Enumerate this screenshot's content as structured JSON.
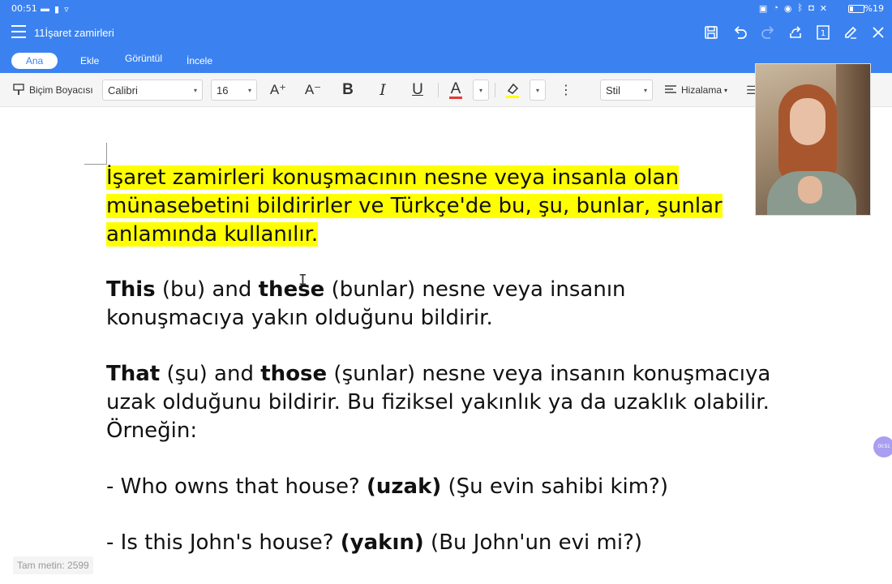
{
  "status_bar": {
    "time": "00:51",
    "battery_percent": "%19",
    "icons": [
      "video-icon",
      "sim-icon",
      "wifi-icon",
      "cast-icon",
      "speed-icon",
      "eye-icon",
      "bluetooth-icon",
      "camera-icon",
      "mute-icon",
      "battery-icon"
    ]
  },
  "title_bar": {
    "doc_title": "11İşaret zamirleri",
    "page_number": "1",
    "icons": [
      "menu-icon",
      "save-icon",
      "undo-icon",
      "redo-icon",
      "share-icon",
      "page-icon",
      "edit-icon",
      "close-icon"
    ]
  },
  "tabs": [
    {
      "label": "Ana Sayfa",
      "active": true
    },
    {
      "label": "Ekle",
      "active": false
    },
    {
      "label": "Görüntül",
      "active": false
    },
    {
      "label": "İncele",
      "active": false
    }
  ],
  "toolbar": {
    "format_painter_label": "Biçim Boyacısı",
    "font_name": "Calibri",
    "font_size": "16",
    "grow_font_glyph": "A⁺",
    "shrink_font_glyph": "A⁻",
    "bold_glyph": "B",
    "italic_glyph": "I",
    "underline_glyph": "U",
    "font_color_glyph": "A",
    "more_glyph": "⋮",
    "style_label": "Stil",
    "align_label": "Hizalama",
    "colors": {
      "font_color": "#e53935",
      "highlight": "#ffff00",
      "accent": "#3b82f0"
    }
  },
  "document": {
    "para1": "İşaret zamirleri konuşmacının nesne veya insanla olan münasebetini bildirirler ve Türkçe'de bu, şu, bunlar, şunlar anlamında kullanılır.",
    "para2": {
      "w1": "This",
      "t1": " (bu) and ",
      "w2": "these",
      "t2": " (bunlar) nesne veya insanın konuşmacıya yakın olduğunu bildirir."
    },
    "para3": {
      "w1": "That",
      "t1": " (şu) and ",
      "w2": "those",
      "t2": " (şunlar) nesne veya insanın konuşmacıya uzak olduğunu bildirir. Bu fiziksel yakınlık ya da uzaklık olabilir. Örneğin:"
    },
    "example1": {
      "t1": "- Who owns that house? ",
      "b1": "(uzak)",
      "t2": " (Şu evin sahibi kim?)"
    },
    "example2": {
      "t1": "- Is this John's house? ",
      "b1": "(yakın)",
      "t2": " (Bu John'un evi mi?)"
    }
  },
  "word_count": "Tam metin: 2599",
  "floating_button_text": "00:51"
}
